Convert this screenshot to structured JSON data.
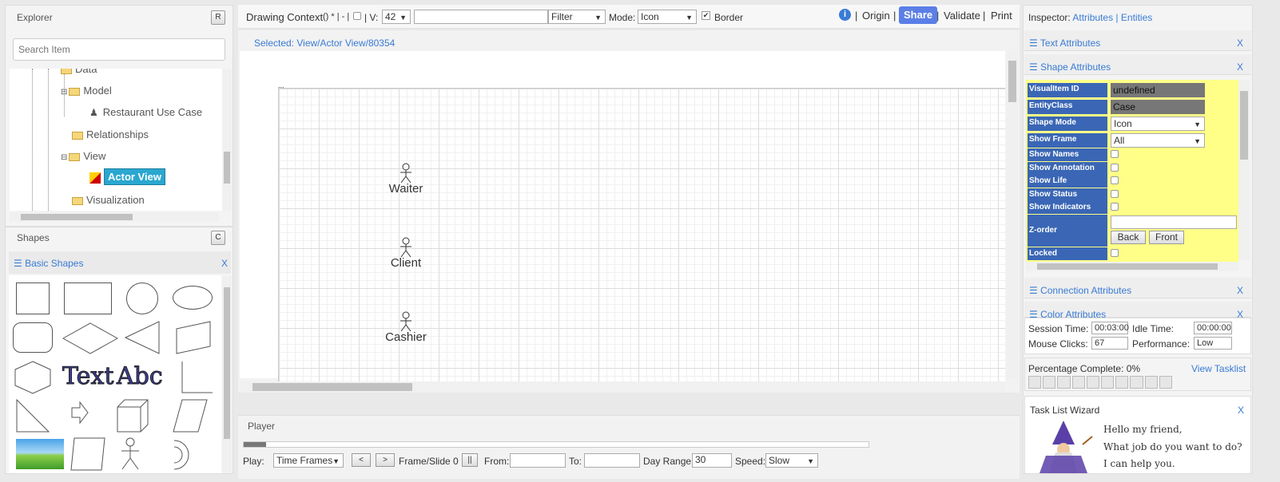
{
  "explorer": {
    "title": "Explorer",
    "refresh_btn": "R",
    "search_placeholder": "Search Item",
    "tree": [
      {
        "label": "Data"
      },
      {
        "label": "Model"
      },
      {
        "label": "Restaurant Use Case"
      },
      {
        "label": "Relationships"
      },
      {
        "label": "View"
      },
      {
        "label": "Actor View"
      },
      {
        "label": "Visualization"
      }
    ]
  },
  "shapes": {
    "title": "Shapes",
    "clear_btn": "C",
    "section": "☰ Basic Shapes",
    "close": "X",
    "text1": "Text",
    "text2": "Abc"
  },
  "toolbar": {
    "context": "Drawing Context",
    "ctx_extra": "() * | - |",
    "v_label": "| V:",
    "v_value": "42",
    "filter": "Filter",
    "mode_label": "Mode:",
    "mode_value": "Icon",
    "border_label": "Border",
    "info": "i",
    "origin": "Origin",
    "share": "Share",
    "validate": "Validate",
    "print": "Print",
    "sep": "|"
  },
  "canvas": {
    "selected": "Selected: View/Actor View/80354",
    "corner": "...",
    "actors": [
      "Waiter",
      "Client",
      "Cashier"
    ]
  },
  "player": {
    "title": "Player",
    "play_label": "Play:",
    "play_mode": "Time Frames",
    "prev": "<",
    "next": ">",
    "frame": "Frame/Slide 0",
    "pause": "||",
    "from": "From:",
    "to": "To:",
    "day_range": "Day Range:",
    "day_value": "30",
    "speed": "Speed:",
    "speed_value": "Slow"
  },
  "inspector": {
    "title": "Inspector:",
    "attributes": "Attributes",
    "sep": "|",
    "entities": "Entities",
    "text_attr": "☰ Text Attributes",
    "shape_attr": "☰ Shape Attributes",
    "conn_attr": "☰ Connection Attributes",
    "color_attr": "☰ Color Attributes",
    "close": "X",
    "rows": {
      "visual_id": "VisualItem ID",
      "visual_id_val": "undefined",
      "entity": "EntityClass",
      "entity_val": "Case",
      "shape_mode": "Shape Mode",
      "shape_mode_val": "Icon",
      "show_frame": "Show Frame",
      "show_frame_val": "All",
      "show_names": "Show Names",
      "show_annotation": "Show Annotation",
      "show_life": "Show Life",
      "show_status": "Show Status",
      "show_indicators": "Show Indicators",
      "zorder": "Z-order",
      "back": "Back",
      "front": "Front",
      "locked": "Locked"
    }
  },
  "session": {
    "time_label": "Session Time:",
    "time": "00:03:00",
    "idle_label": "Idle Time:",
    "idle": "00:00:00",
    "clicks_label": "Mouse Clicks:",
    "clicks": "67",
    "perf_label": "Performance:",
    "perf": "Low"
  },
  "progress": {
    "label": "Percentage Complete: 0%",
    "view": "View Tasklist",
    "percent": 0
  },
  "wizard": {
    "title": "Task List Wizard",
    "close": "X",
    "line1": "Hello my friend,",
    "line2": "What job do you want to do?",
    "line3": "I can help you."
  },
  "colors": {
    "accent": "#3a7bd5",
    "share_bg": "#5b7fe6",
    "label_bg": "#3a66b5",
    "value_bg": "#ffff88",
    "select_bg": "#2aa7d0"
  }
}
